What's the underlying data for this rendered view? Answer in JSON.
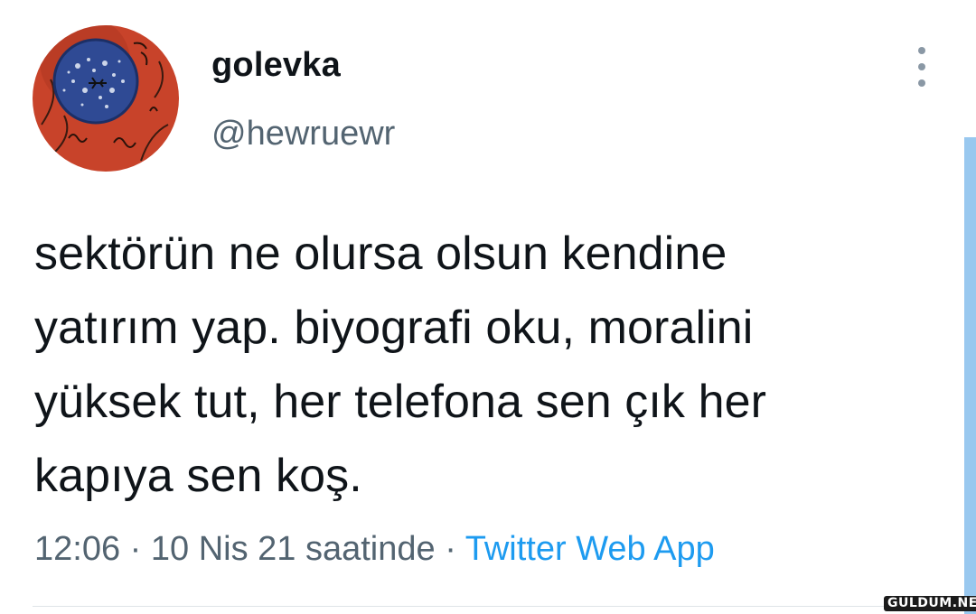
{
  "user": {
    "display_name": "golevka",
    "handle": "@hewruewr",
    "avatar_icon": "profile-avatar-art"
  },
  "tweet": {
    "text": "sektörün ne olursa olsun kendine\nyatırım yap. biyografi oku, moralini\nyüksek tut, her telefona sen çık her\nkapıya sen koş.",
    "time": "12:06",
    "separator": "·",
    "date": "10 Nis 21",
    "date_suffix": "saatinde",
    "source": "Twitter Web App"
  },
  "menu": {
    "icon": "more-vertical-icon"
  },
  "watermark": "GULDUM.NET",
  "colors": {
    "text_primary": "#0f1419",
    "text_secondary": "#536471",
    "link": "#1d9bf0",
    "scrollbar": "#99c8ef"
  }
}
